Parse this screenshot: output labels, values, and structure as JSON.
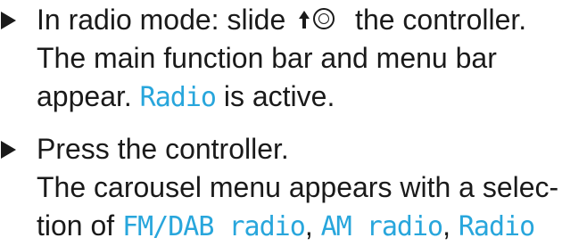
{
  "instructions": {
    "step1": {
      "line1_a": "In radio mode: slide",
      "line1_b": "the controller.",
      "line2": "The main function bar and menu bar",
      "line3_a": "appear.",
      "line3_hl": "Radio",
      "line3_b": "is active."
    },
    "step2": {
      "line1": "Press the controller.",
      "line2": "The carousel menu appears with a selec-",
      "line3_a": "tion of",
      "line3_hl1": "FM/DAB radio",
      "line3_sep1": ",",
      "line3_hl2": "AM radio",
      "line3_sep2": ",",
      "line3_hl3": "Radio"
    },
    "controller_icon": "controller-slide-up-icon",
    "highlight_color": "#28a6dc"
  }
}
